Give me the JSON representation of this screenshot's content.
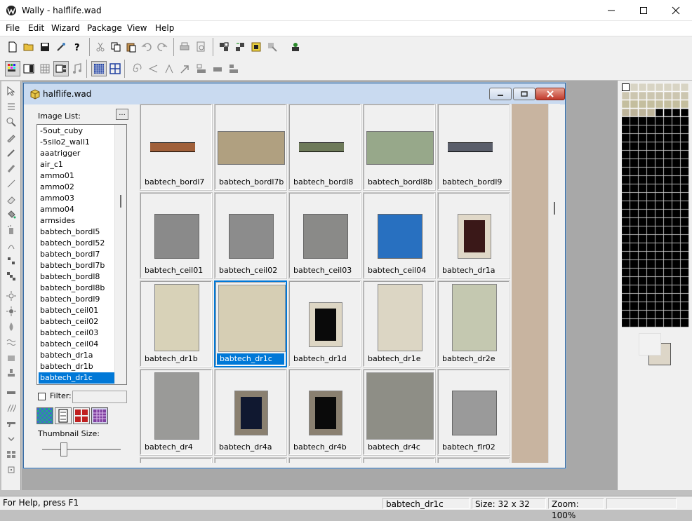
{
  "window": {
    "title": "Wally - halflife.wad"
  },
  "menu": [
    "File",
    "Edit",
    "Wizard",
    "Package",
    "View",
    "Help"
  ],
  "child": {
    "title": "halflife.wad"
  },
  "panel": {
    "image_list_label": "Image List:",
    "more_button": "...",
    "filter_label": "Filter:",
    "filter_value": "",
    "thumbnail_size_label": "Thumbnail Size:",
    "thumbnail_size_level": 0.25
  },
  "image_list": [
    "-5out_cuby",
    "-5silo2_wall1",
    "aaatrigger",
    "air_c1",
    "ammo01",
    "ammo02",
    "ammo03",
    "ammo04",
    "armsides",
    "babtech_bordl5",
    "babtech_bordl52",
    "babtech_bordl7",
    "babtech_bordl7b",
    "babtech_bordl8",
    "babtech_bordl8b",
    "babtech_bordl9",
    "babtech_ceil01",
    "babtech_ceil02",
    "babtech_ceil03",
    "babtech_ceil04",
    "babtech_dr1a",
    "babtech_dr1b",
    "babtech_dr1c"
  ],
  "selected_item": "babtech_dr1c",
  "thumbnails": [
    {
      "name": "babtech_bordl7",
      "kind": "strip",
      "color": "#a0603a"
    },
    {
      "name": "babtech_bordl7b",
      "kind": "panel",
      "color": "#b0a080"
    },
    {
      "name": "babtech_bordl8",
      "kind": "strip",
      "color": "#6e7a5a"
    },
    {
      "name": "babtech_bordl8b",
      "kind": "panel",
      "color": "#97a88a"
    },
    {
      "name": "babtech_bordl9",
      "kind": "strip",
      "color": "#5a5e6a"
    },
    {
      "name": "babtech_ceil01",
      "kind": "square",
      "color": "#8a8a8a"
    },
    {
      "name": "babtech_ceil02",
      "kind": "square",
      "color": "#8c8c8c"
    },
    {
      "name": "babtech_ceil03",
      "kind": "square",
      "color": "#8a8a88"
    },
    {
      "name": "babtech_ceil04",
      "kind": "square",
      "color": "#2870c0"
    },
    {
      "name": "babtech_dr1a",
      "kind": "door",
      "color": "#e0d8c8",
      "inner": "#3a1818"
    },
    {
      "name": "babtech_dr1b",
      "kind": "tall",
      "color": "#d8d2b8"
    },
    {
      "name": "babtech_dr1c",
      "kind": "big",
      "color": "#d6ceb4",
      "selected": true
    },
    {
      "name": "babtech_dr1d",
      "kind": "door",
      "color": "#ddd6c4",
      "inner": "#0a0a0a"
    },
    {
      "name": "babtech_dr1e",
      "kind": "tall",
      "color": "#dcd6c4"
    },
    {
      "name": "babtech_dr2e",
      "kind": "tall",
      "color": "#c4c8b0"
    },
    {
      "name": "babtech_dr4",
      "kind": "tall",
      "color": "#9a9a98"
    },
    {
      "name": "babtech_dr4a",
      "kind": "door",
      "color": "#8a8070",
      "inner": "#101830"
    },
    {
      "name": "babtech_dr4b",
      "kind": "door",
      "color": "#8a8070",
      "inner": "#0a0a0a"
    },
    {
      "name": "babtech_dr4c",
      "kind": "big",
      "color": "#8e8e86"
    },
    {
      "name": "babtech_flr02",
      "kind": "square",
      "color": "#9a9a9a"
    }
  ],
  "status": {
    "help": "For Help, press F1",
    "name": "babtech_dr1c",
    "size": "Size: 32 x 32",
    "zoom": "Zoom: 100%"
  }
}
